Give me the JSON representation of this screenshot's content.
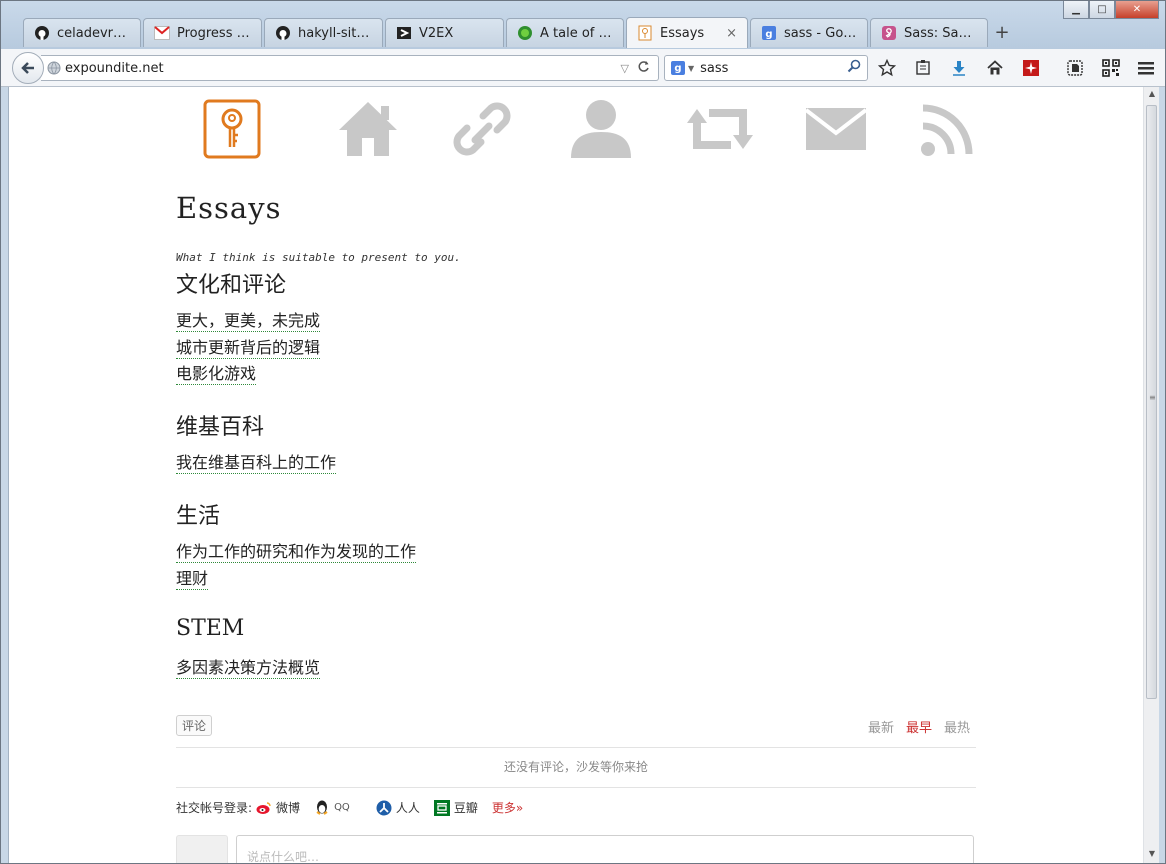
{
  "browser": {
    "tabs": [
      {
        "label": "celadevra/B…",
        "icon": "github-icon"
      },
      {
        "label": "Progress R…",
        "icon": "gmail-icon"
      },
      {
        "label": "hakyll-site/…",
        "icon": "github-icon"
      },
      {
        "label": "V2EX",
        "icon": "v2ex-icon"
      },
      {
        "label": "A tale of tra…",
        "icon": "green-circle-icon"
      },
      {
        "label": "Essays",
        "icon": "page-icon",
        "active": true
      },
      {
        "label": "sass - Goo…",
        "icon": "google-icon"
      },
      {
        "label": "Sass: Sass …",
        "icon": "sass-icon"
      }
    ],
    "tab_close": "×",
    "new_tab": "+",
    "url": "expoundite.net",
    "search_engine_letter": "g",
    "search_value": "sass"
  },
  "page": {
    "title": "Essays",
    "subtitle": "What I think is suitable to present to you.",
    "sections": [
      {
        "title": "文化和评论",
        "links": [
          "更大，更美，未完成",
          "城市更新背后的逻辑",
          "电影化游戏"
        ]
      },
      {
        "title": "维基百科",
        "links": [
          "我在维基百科上的工作"
        ]
      },
      {
        "title": "生活",
        "links": [
          "作为工作的研究和作为发现的工作",
          "理财"
        ]
      },
      {
        "title": "STEM",
        "links": [
          "多因素决策方法概览"
        ]
      }
    ]
  },
  "comments": {
    "tag": "评论",
    "sort": [
      "最新",
      "最早",
      "最热"
    ],
    "active_sort": "最早",
    "empty_message": "还没有评论，沙发等你来抢",
    "social_label": "社交帐号登录:",
    "social": [
      "微博",
      "QQ",
      "人人",
      "豆瓣"
    ],
    "more": "更多»",
    "input_placeholder": "说点什么吧…"
  },
  "colors": {
    "accent": "#e07a1f",
    "nav_icon_gray": "#c8c8c8",
    "link_underline": "#2f8a3a",
    "sort_active": "#cc3333"
  }
}
